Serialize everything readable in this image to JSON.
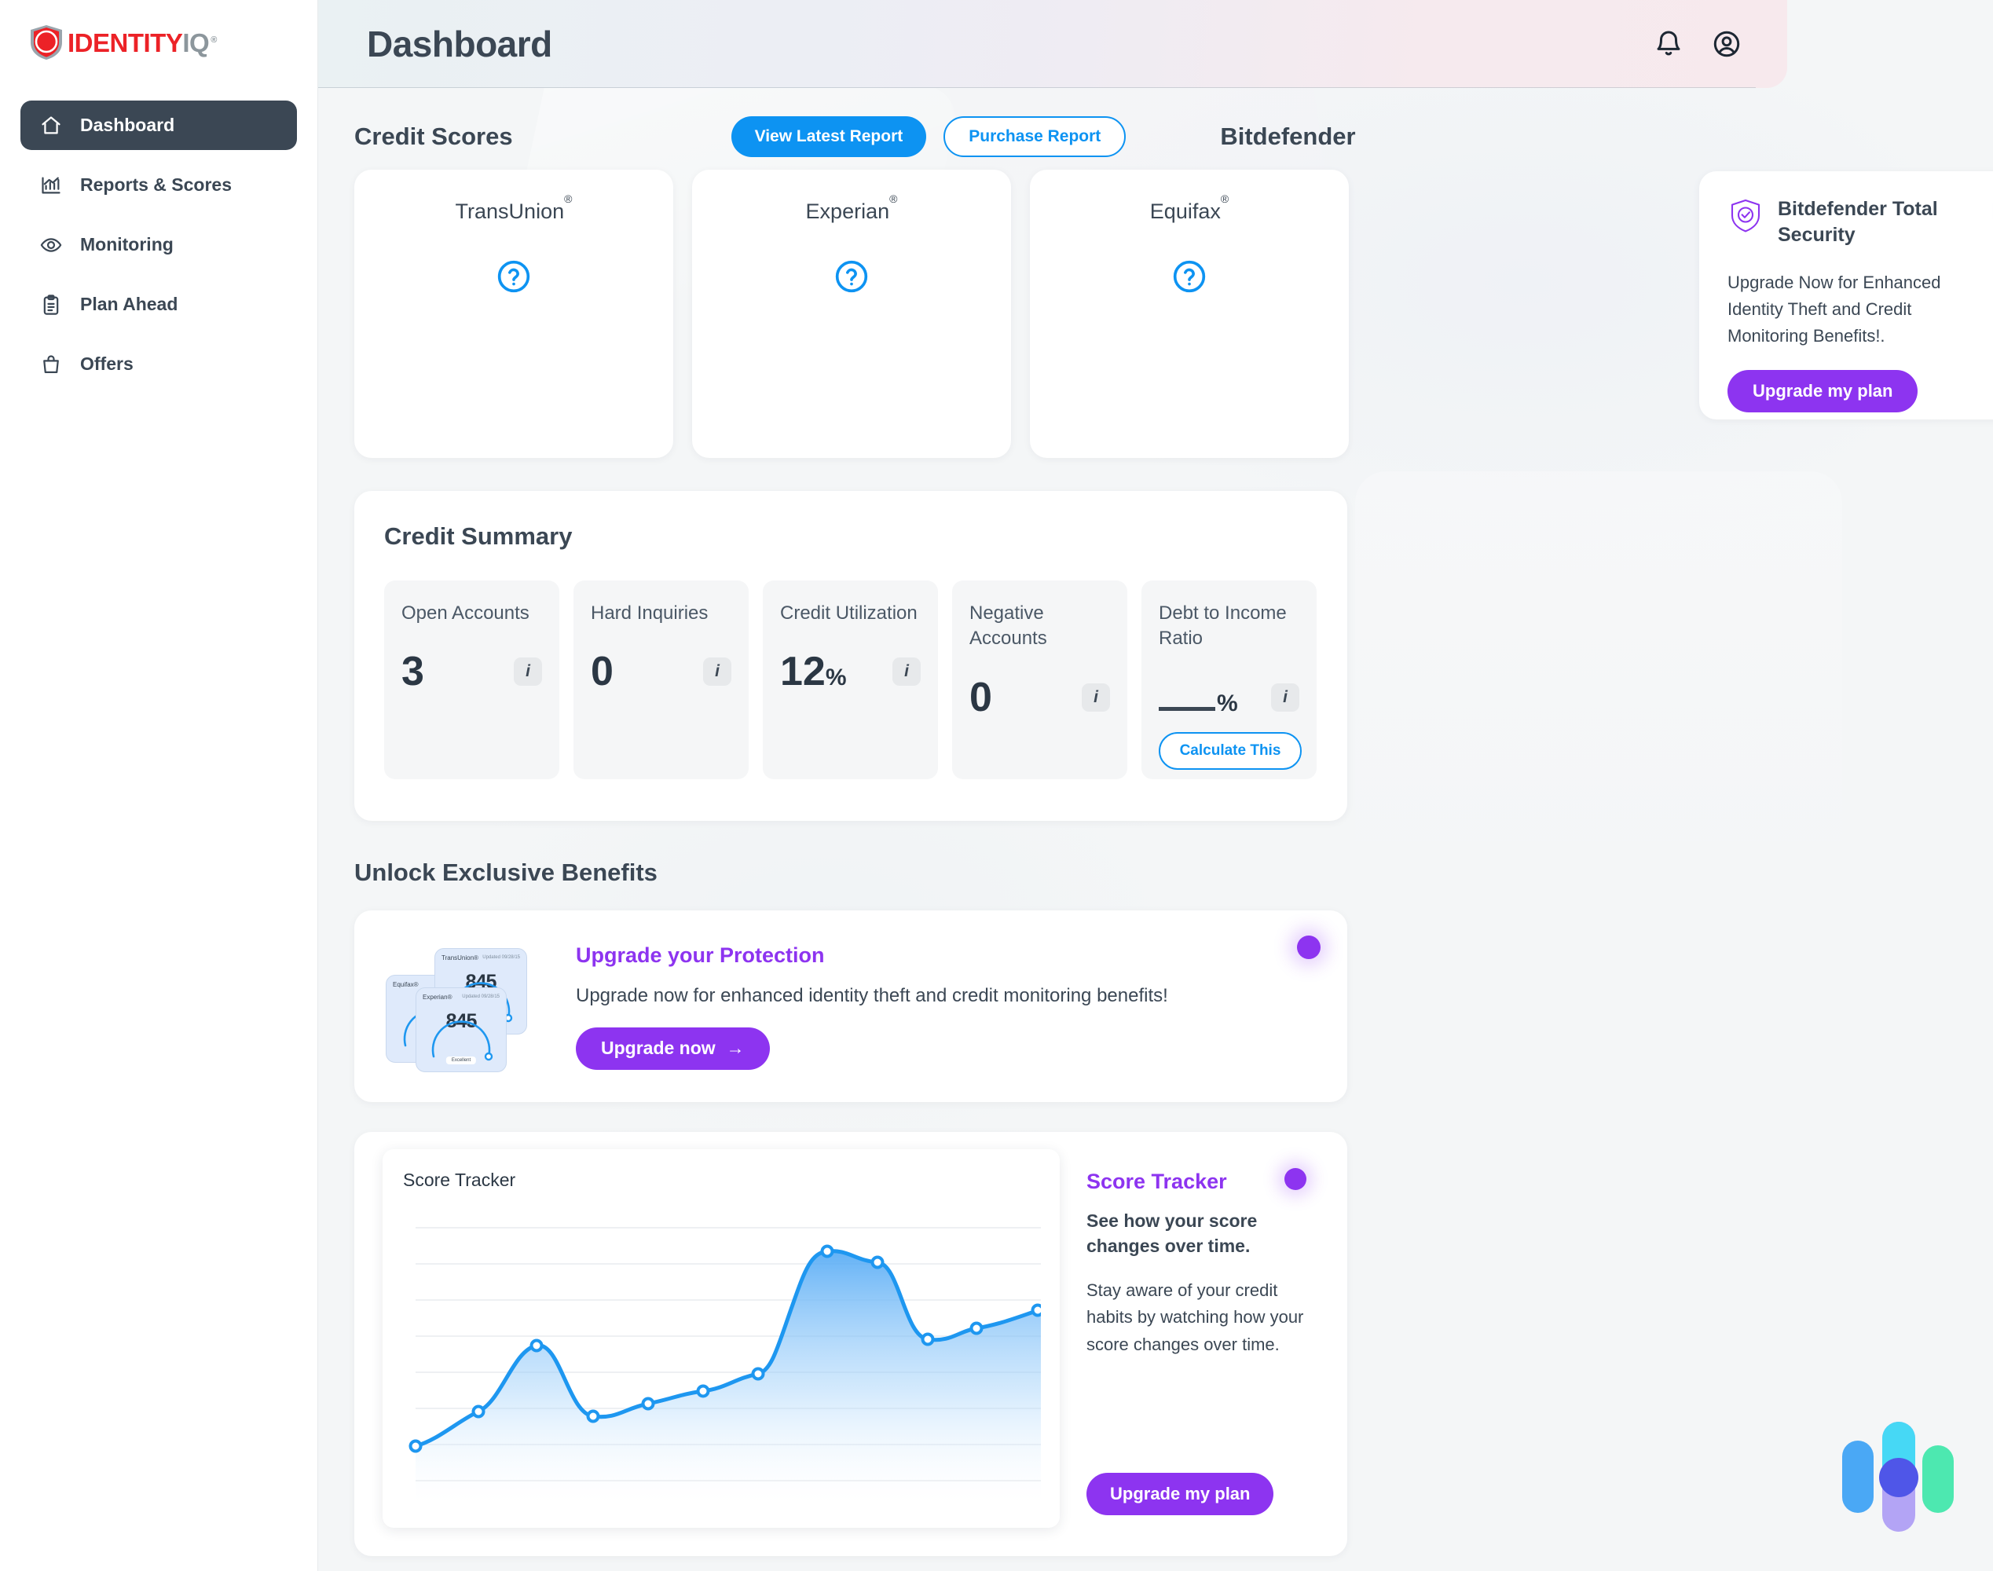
{
  "brand": {
    "name_primary": "IDENTITY",
    "name_secondary": "IQ",
    "registered_mark": "®",
    "color_primary": "#ec2227",
    "color_secondary": "#8c969c"
  },
  "sidebar": {
    "items": [
      {
        "label": "Dashboard",
        "icon": "home-icon",
        "active": true
      },
      {
        "label": "Reports & Scores",
        "icon": "bar-chart-icon",
        "active": false
      },
      {
        "label": "Monitoring",
        "icon": "eye-icon",
        "active": false
      },
      {
        "label": "Plan Ahead",
        "icon": "clipboard-icon",
        "active": false
      },
      {
        "label": "Offers",
        "icon": "bag-icon",
        "active": false
      }
    ]
  },
  "header": {
    "title": "Dashboard",
    "notifications_icon": "bell-icon",
    "account_icon": "user-circle-icon"
  },
  "credit_scores": {
    "section_title": "Credit Scores",
    "view_latest_report_label": "View Latest Report",
    "purchase_report_label": "Purchase Report",
    "accent_color": "#0d93f2",
    "bureaus": [
      {
        "name": "TransUnion",
        "mark": "®",
        "score_state": "?"
      },
      {
        "name": "Experian",
        "mark": "®",
        "score_state": "?"
      },
      {
        "name": "Equifax",
        "mark": "®",
        "score_state": "?"
      }
    ]
  },
  "bitdefender": {
    "section_title": "Bitdefender",
    "card_title": "Bitdefender Total Security",
    "card_body": "Upgrade Now for Enhanced Identity Theft and Credit Monitoring Benefits!.",
    "cta_label": "Upgrade my plan",
    "accent_color": "#8d34f0",
    "icon": "shield-check-icon"
  },
  "credit_summary": {
    "title": "Credit Summary",
    "calculate_label": "Calculate This",
    "info_glyph": "i",
    "stats": [
      {
        "label": "Open Accounts",
        "value": "3",
        "suffix": ""
      },
      {
        "label": "Hard Inquiries",
        "value": "0",
        "suffix": ""
      },
      {
        "label": "Credit Utilization",
        "value": "12",
        "suffix": "%"
      },
      {
        "label": "Negative Accounts",
        "value": "0",
        "suffix": ""
      },
      {
        "label": "Debt to Income Ratio",
        "value": "__",
        "suffix": "%"
      }
    ]
  },
  "unlock": {
    "title": "Unlock Exclusive Benefits",
    "promo_title": "Upgrade your Protection",
    "promo_body": "Upgrade now for enhanced identity theft and credit monitoring benefits!",
    "cta_label": "Upgrade now",
    "cta_arrow": "→",
    "art_cards": [
      {
        "bureau": "Equifax®",
        "updated": "Updated 09/28/15",
        "score": "845",
        "rating": "Excellent"
      },
      {
        "bureau": "TransUnion®",
        "updated": "Updated 09/28/15",
        "score": "845",
        "rating": "Excellent"
      },
      {
        "bureau": "Experian®",
        "updated": "Updated 09/28/15",
        "score": "845",
        "rating": "Excellent"
      }
    ]
  },
  "score_tracker": {
    "panel_title": "Score Tracker",
    "bold_line": "See how your score changes over time.",
    "body": "Stay aware of your credit habits by watching how your score changes over time.",
    "cta_label": "Upgrade my plan",
    "chart_title": "Score Tracker"
  },
  "chat_widget": {
    "icon": "chat-assistant-icon",
    "colors": [
      "#4aa8f5",
      "#46d8f5",
      "#b3a4f5",
      "#4f56e8",
      "#4de8b0"
    ]
  },
  "chart_data": {
    "type": "area",
    "title": "Score Tracker",
    "xlabel": "",
    "ylabel": "",
    "grid": true,
    "legend": "none",
    "line_color": "#1e97f0",
    "fill_gradient": [
      "#56abf5",
      "#ffffff"
    ],
    "x": [
      1,
      2,
      3,
      4,
      5,
      6,
      7,
      8,
      9,
      10,
      11
    ],
    "values": [
      12,
      33,
      57,
      30,
      34,
      39,
      44,
      78,
      75,
      57,
      62,
      67
    ],
    "series": [
      {
        "name": "Credit score",
        "values": [
          12,
          33,
          57,
          30,
          34,
          39,
          44,
          78,
          75,
          57,
          62,
          67
        ]
      }
    ],
    "ylim": [
      0,
      100
    ],
    "gridline_count": 7,
    "point_count": 11
  }
}
